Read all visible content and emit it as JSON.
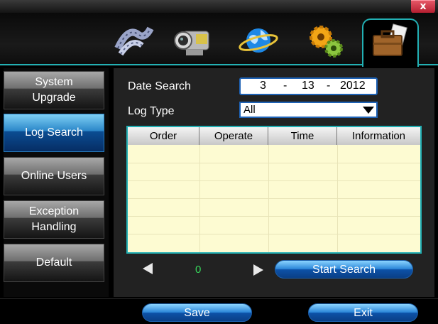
{
  "window": {
    "close_label": "x"
  },
  "nav_icons": [
    {
      "name": "playback-film-icon"
    },
    {
      "name": "camera-record-icon"
    },
    {
      "name": "network-globe-icon"
    },
    {
      "name": "settings-gears-icon"
    },
    {
      "name": "toolbox-management-icon"
    }
  ],
  "sidebar": {
    "items": [
      {
        "label": "System\nUpgrade"
      },
      {
        "label": "Log Search"
      },
      {
        "label": "Online Users"
      },
      {
        "label": "Exception\nHandling"
      },
      {
        "label": "Default"
      }
    ]
  },
  "date_search": {
    "label": "Date Search",
    "day": "3",
    "month": "13",
    "year": "2012",
    "sep1": "-",
    "sep2": "-"
  },
  "log_type": {
    "label": "Log Type",
    "value": "All"
  },
  "table": {
    "columns": [
      "Order",
      "Operate",
      "Time",
      "Information"
    ],
    "rows": []
  },
  "pager": {
    "page": "0"
  },
  "buttons": {
    "start_search": "Start Search",
    "save": "Save",
    "exit": "Exit"
  },
  "colors": {
    "accent": "#22b0b4",
    "active_blue": "#1e62b5",
    "table_bg": "#fdfbd2",
    "page_num": "#36d55a"
  }
}
